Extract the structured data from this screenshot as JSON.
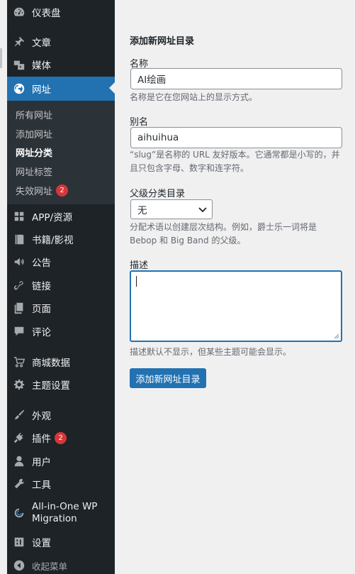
{
  "sidebar": {
    "items": [
      {
        "label": "仪表盘",
        "icon": "dashboard-icon"
      },
      {
        "label": "文章",
        "icon": "pin-icon"
      },
      {
        "label": "媒体",
        "icon": "media-icon"
      },
      {
        "label": "网址",
        "icon": "globe-icon",
        "active": true
      },
      {
        "label": "APP/资源",
        "icon": "grid-icon"
      },
      {
        "label": "书籍/影视",
        "icon": "book-icon"
      },
      {
        "label": "公告",
        "icon": "megaphone-icon"
      },
      {
        "label": "链接",
        "icon": "link-icon"
      },
      {
        "label": "页面",
        "icon": "page-icon"
      },
      {
        "label": "评论",
        "icon": "comment-icon"
      },
      {
        "label": "商城数据",
        "icon": "cart-icon"
      },
      {
        "label": "主题设置",
        "icon": "gear-icon"
      },
      {
        "label": "外观",
        "icon": "brush-icon"
      },
      {
        "label": "插件",
        "icon": "plugin-icon",
        "badge": "2"
      },
      {
        "label": "用户",
        "icon": "user-icon"
      },
      {
        "label": "工具",
        "icon": "wrench-icon"
      },
      {
        "label": "All-in-One WP",
        "label_line2": "Migration",
        "icon": "migration-icon"
      },
      {
        "label": "设置",
        "icon": "settings-icon"
      },
      {
        "label": "收起菜单",
        "icon": "collapse-icon"
      }
    ],
    "submenu": [
      {
        "label": "所有网址"
      },
      {
        "label": "添加网址"
      },
      {
        "label": "网址分类",
        "current": true
      },
      {
        "label": "网址标签"
      },
      {
        "label": "失效网址",
        "badge": "2"
      }
    ]
  },
  "form": {
    "title": "添加新网址目录",
    "name_label": "名称",
    "name_value": "AI绘画",
    "name_desc": "名称是它在您网站上的显示方式。",
    "slug_label": "别名",
    "slug_value": "aihuihua",
    "slug_desc_line1": "“slug”是名称的 URL 友好版本。它通常都是小写的，并",
    "slug_desc_line2": "且只包含字母、数字和连字符。",
    "parent_label": "父级分类目录",
    "parent_value": "无",
    "parent_desc_line1": "分配术语以创建层次结构。例如，爵士乐一词将是",
    "parent_desc_line2": "Bebop 和 Big Band 的父级。",
    "desc_label": "描述",
    "desc_value": "",
    "desc_desc": "描述默认不显示，但某些主题可能会显示。",
    "submit_label": "添加新网址目录"
  },
  "colors": {
    "sidebar_bg": "#1d2327",
    "submenu_bg": "#2c3338",
    "accent": "#2271b1",
    "badge": "#d63638",
    "page_bg": "#f0f0f1"
  }
}
